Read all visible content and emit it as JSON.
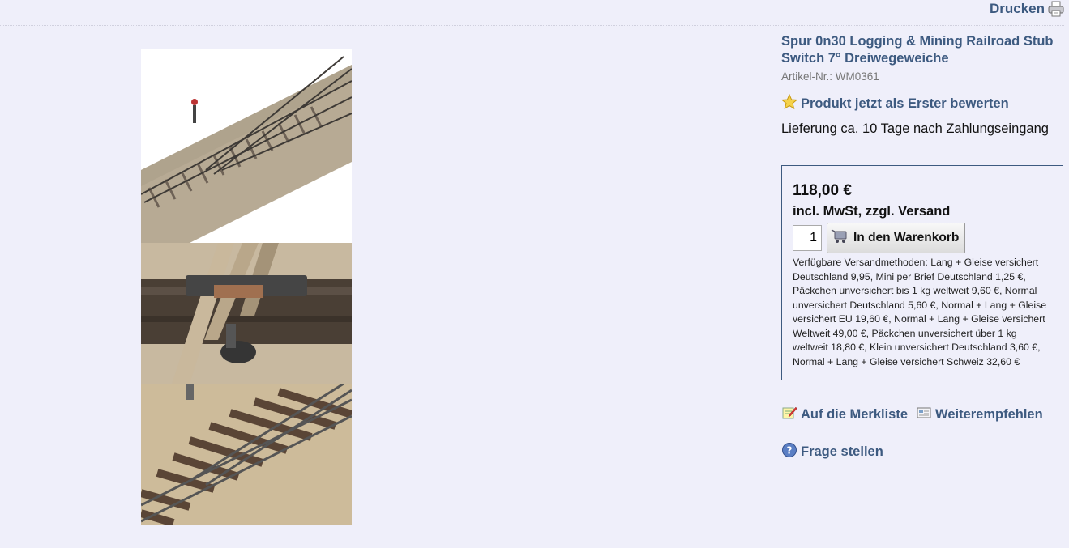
{
  "header": {
    "print_label": "Drucken",
    "print_icon": "printer-icon"
  },
  "product": {
    "title": "Spur 0n30 Logging & Mining Railroad Stub Switch 7° Dreiwegeweiche",
    "article_label": "Artikel-Nr.:",
    "article_number": "WM0361",
    "rate_label": "Produkt jetzt als Erster bewerten",
    "delivery": "Lieferung ca. 10 Tage nach Zahlungseingang"
  },
  "price_box": {
    "price": "118,00 €",
    "tax_note": "incl. MwSt, zzgl. Versand",
    "quantity": "1",
    "cart_button": "In den Warenkorb",
    "shipping_methods": "Verfügbare Versandmethoden: Lang + Gleise versichert Deutschland 9,95, Mini per Brief Deutschland 1,25 €, Päckchen unversichert bis 1 kg weltweit 9,60 €, Normal unversichert Deutschland 5,60 €, Normal + Lang + Gleise versichert EU 19,60 €, Normal + Lang + Gleise versichert Weltweit 49,00 €, Päckchen unversichert über 1 kg weltweit 18,80 €, Klein unversichert Deutschland 3,60 €, Normal + Lang + Gleise versichert Schweiz 32,60 €"
  },
  "actions": {
    "wishlist": "Auf die Merkliste",
    "recommend": "Weiterempfehlen",
    "question": "Frage stellen"
  },
  "colors": {
    "link": "#3d5a80",
    "background": "#efeffa",
    "border": "#3d5a80"
  },
  "gallery_images": [
    "three-way-stub-switch-overview",
    "switch-stand-closeup",
    "switch-frog-closeup"
  ]
}
